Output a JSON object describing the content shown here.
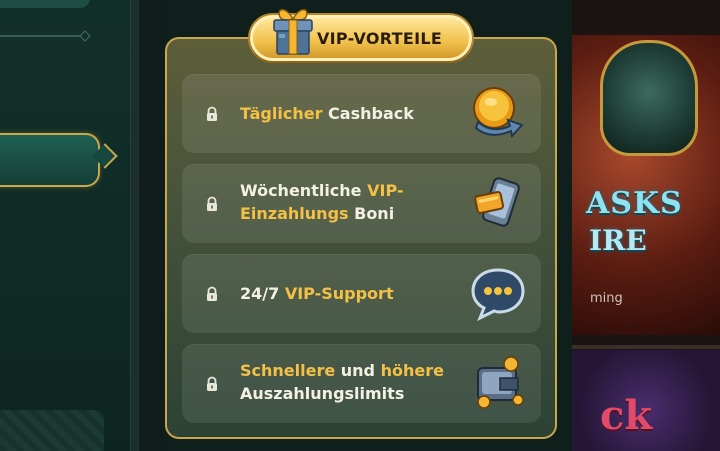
{
  "vip": {
    "title": "VIP-VORTEILE",
    "benefits": [
      {
        "lead": "Täglicher",
        "rest": " Cashback"
      },
      {
        "line1_plain": "Wöchentliche ",
        "line1_gold": "VIP-",
        "line2_gold": "Einzahlungs",
        "line2_plain": " Boni"
      },
      {
        "plain": "24/7 ",
        "gold": "VIP-Support"
      },
      {
        "gold1": "Schnellere",
        "plain1": " und ",
        "gold2": "höhere",
        "line2": "Auszahlungslimits"
      }
    ]
  },
  "game_art": {
    "title_line1": "ASKS",
    "title_line2": "IRE",
    "subtitle": "ming",
    "bottom_text": "ck"
  },
  "icons": {
    "gift": "gift-box-icon",
    "lock": "lock-icon",
    "coin": "coin-cashback-icon",
    "phone": "phone-card-icon",
    "chat": "chat-bubble-icon",
    "wallet": "wallet-coins-icon"
  },
  "colors": {
    "accent_gold": "#f4c046",
    "panel_border": "#c9a74a",
    "text_light": "#f3f0e4"
  }
}
